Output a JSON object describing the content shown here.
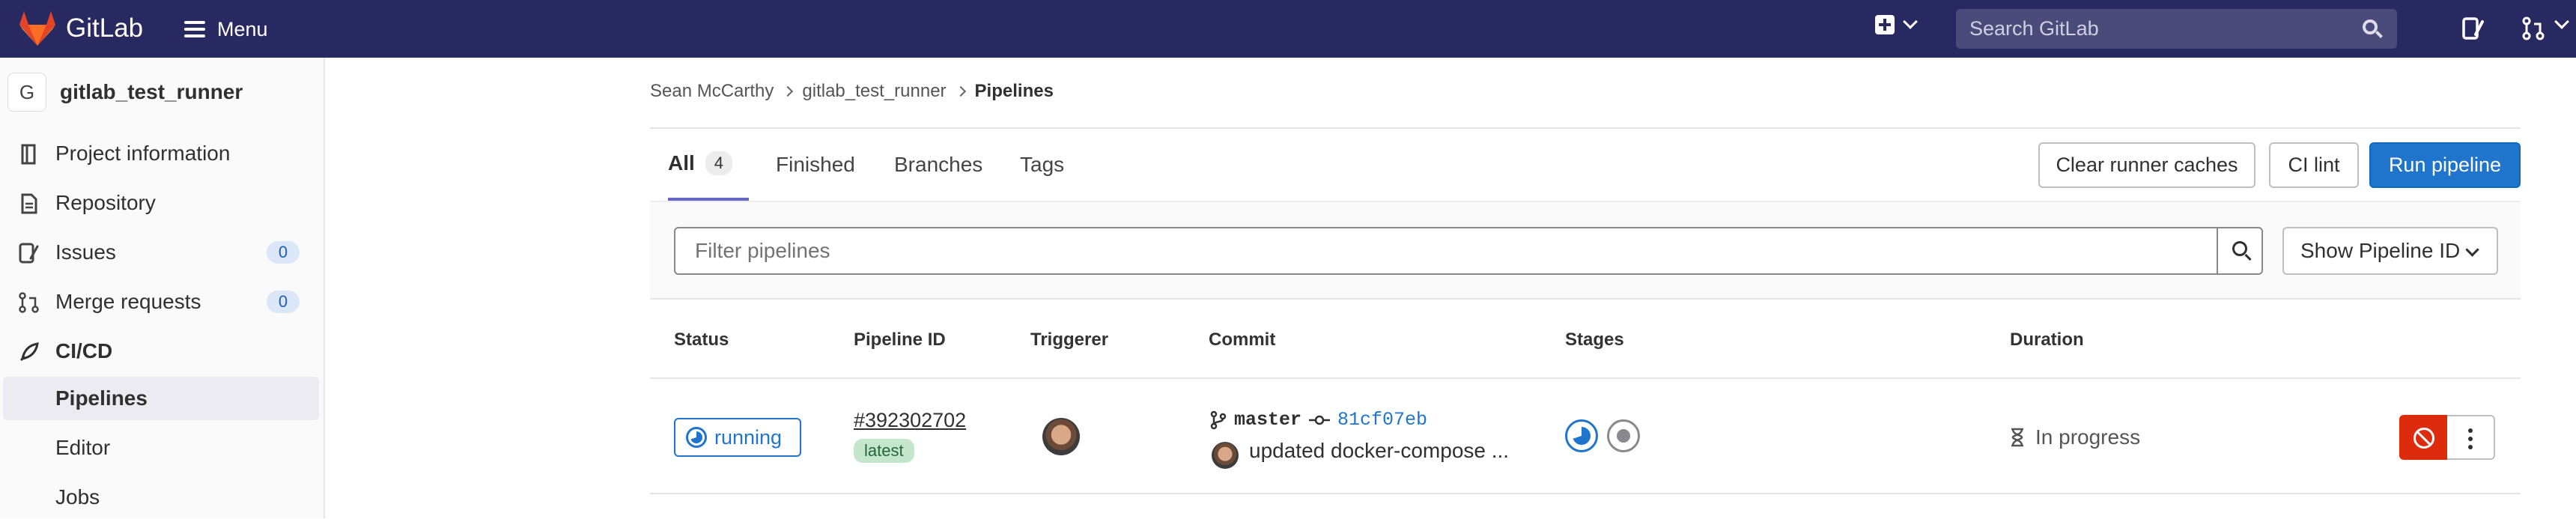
{
  "topbar": {
    "brand": "GitLab",
    "menu_label": "Menu",
    "search_placeholder": "Search GitLab"
  },
  "sidebar": {
    "project_initial": "G",
    "project_name": "gitlab_test_runner",
    "items": [
      {
        "label": "Project information",
        "icon": "project-info-icon"
      },
      {
        "label": "Repository",
        "icon": "repository-icon"
      },
      {
        "label": "Issues",
        "icon": "issues-icon",
        "count": "0"
      },
      {
        "label": "Merge requests",
        "icon": "merge-request-icon",
        "count": "0"
      },
      {
        "label": "CI/CD",
        "icon": "rocket-icon"
      }
    ],
    "sub_items": [
      {
        "label": "Pipelines",
        "active": true
      },
      {
        "label": "Editor"
      },
      {
        "label": "Jobs"
      }
    ]
  },
  "breadcrumb": [
    "Sean McCarthy",
    "gitlab_test_runner",
    "Pipelines"
  ],
  "tabs": [
    {
      "label": "All",
      "count": "4",
      "active": true
    },
    {
      "label": "Finished"
    },
    {
      "label": "Branches"
    },
    {
      "label": "Tags"
    }
  ],
  "actions": {
    "clear_caches": "Clear runner caches",
    "ci_lint": "CI lint",
    "run_pipeline": "Run pipeline"
  },
  "filter": {
    "placeholder": "Filter pipelines",
    "sort_label": "Show Pipeline ID"
  },
  "table": {
    "headers": [
      "Status",
      "Pipeline ID",
      "Triggerer",
      "Commit",
      "Stages",
      "Duration"
    ],
    "rows": [
      {
        "status": "running",
        "pipeline_id": "#392302702",
        "tag": "latest",
        "branch": "master",
        "sha": "81cf07eb",
        "message": "updated docker-compose ...",
        "stages": [
          "running",
          "created"
        ],
        "duration": "In progress"
      }
    ]
  },
  "colors": {
    "topbar": "#292961",
    "primary": "#1f75cb",
    "danger": "#dd2b0e"
  }
}
